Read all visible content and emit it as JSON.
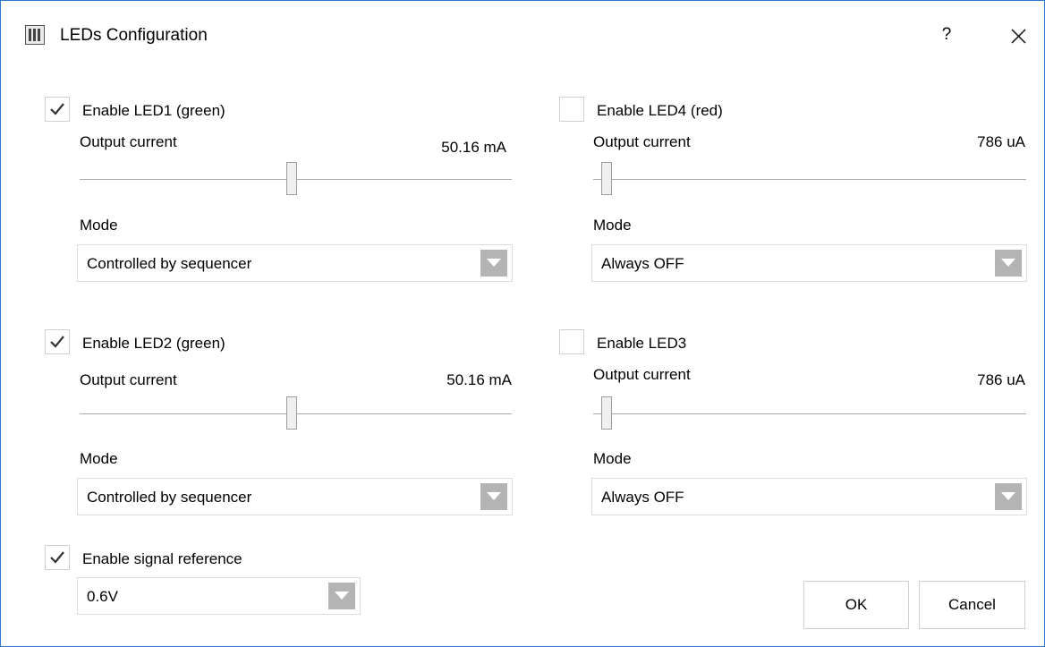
{
  "window": {
    "title": "LEDs Configuration",
    "help_label": "?"
  },
  "common": {
    "output_current_label": "Output current",
    "mode_label": "Mode"
  },
  "leds": {
    "led1": {
      "label": "Enable LED1 (green)",
      "checked": true,
      "current_value": "50.16 mA",
      "slider_fraction": 0.49,
      "mode": "Controlled by sequencer"
    },
    "led4": {
      "label": "Enable LED4 (red)",
      "checked": false,
      "current_value": "786 uA",
      "slider_fraction": 0.03,
      "mode": "Always OFF"
    },
    "led2": {
      "label": "Enable LED2 (green)",
      "checked": true,
      "current_value": "50.16 mA",
      "slider_fraction": 0.49,
      "mode": "Controlled by sequencer"
    },
    "led3": {
      "label": "Enable LED3",
      "checked": false,
      "current_value": "786 uA",
      "slider_fraction": 0.03,
      "mode": "Always OFF"
    }
  },
  "signal_reference": {
    "label": "Enable signal reference",
    "checked": true,
    "value": "0.6V"
  },
  "buttons": {
    "ok": "OK",
    "cancel": "Cancel"
  },
  "colors": {
    "window_border": "#2b79d0",
    "dropdown_arrow_bg": "#b4b4b4",
    "check_mark": "#333333"
  },
  "icons": {
    "app": "app-logo-icon",
    "close": "close-icon",
    "check": "checkmark-icon",
    "dropdown": "chevron-down-icon"
  }
}
